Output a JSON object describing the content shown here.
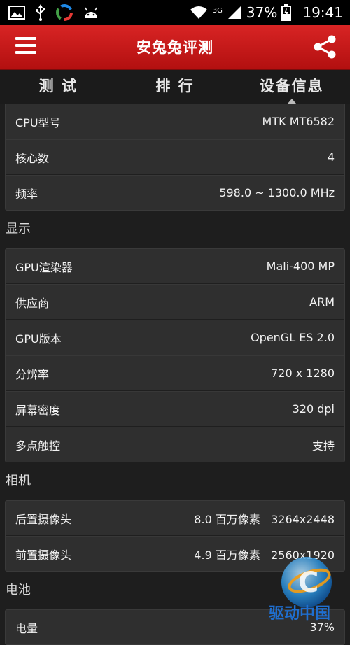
{
  "status_bar": {
    "network_type": "3G",
    "battery_percent": "37%",
    "time": "19:41"
  },
  "header": {
    "title": "安兔兔评测"
  },
  "tabs": [
    {
      "label": "测 试"
    },
    {
      "label": "排 行"
    },
    {
      "label": "设备信息"
    }
  ],
  "cpu": {
    "rows": [
      {
        "label": "CPU型号",
        "value": "MTK MT6582"
      },
      {
        "label": "核心数",
        "value": "4"
      },
      {
        "label": "频率",
        "value": "598.0 ~ 1300.0 MHz"
      }
    ]
  },
  "display": {
    "title": "显示",
    "rows": [
      {
        "label": "GPU渲染器",
        "value": "Mali-400 MP"
      },
      {
        "label": "供应商",
        "value": "ARM"
      },
      {
        "label": "GPU版本",
        "value": "OpenGL ES 2.0"
      },
      {
        "label": "分辨率",
        "value": "720 x 1280"
      },
      {
        "label": "屏幕密度",
        "value": "320 dpi"
      },
      {
        "label": "多点触控",
        "value": "支持"
      }
    ]
  },
  "camera": {
    "title": "相机",
    "rows": [
      {
        "label": "后置摄像头",
        "value": "8.0 百万像素   3264x2448"
      },
      {
        "label": "前置摄像头",
        "value": "4.9 百万像素   2560x1920"
      }
    ]
  },
  "battery": {
    "title": "电池",
    "rows": [
      {
        "label": "电量",
        "value": "37%"
      }
    ]
  },
  "watermark": {
    "text": "驱动中国"
  },
  "colors": {
    "header_red": "#c81a1a",
    "background": "#1e1e1e",
    "card": "#2f2f2f"
  }
}
